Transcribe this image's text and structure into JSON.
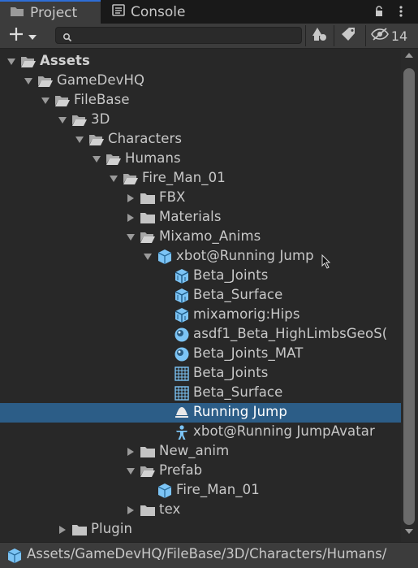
{
  "tabs": [
    {
      "label": "Project",
      "icon": "folder-icon",
      "active": true
    },
    {
      "label": "Console",
      "icon": "console-icon",
      "active": false
    }
  ],
  "toolbar": {
    "create_icon": "plus-icon",
    "search_value": "",
    "hidden_count": "14"
  },
  "tree": [
    {
      "label": "Assets",
      "icon": "folder-open-icon",
      "depth": 0,
      "expanded": true,
      "bold": true
    },
    {
      "label": "GameDevHQ",
      "icon": "folder-open-icon",
      "depth": 1,
      "expanded": true
    },
    {
      "label": "FileBase",
      "icon": "folder-open-icon",
      "depth": 2,
      "expanded": true
    },
    {
      "label": "3D",
      "icon": "folder-open-icon",
      "depth": 3,
      "expanded": true
    },
    {
      "label": "Characters",
      "icon": "folder-open-icon",
      "depth": 4,
      "expanded": true
    },
    {
      "label": "Humans",
      "icon": "folder-open-icon",
      "depth": 5,
      "expanded": true
    },
    {
      "label": "Fire_Man_01",
      "icon": "folder-open-icon",
      "depth": 6,
      "expanded": true
    },
    {
      "label": "FBX",
      "icon": "folder-icon",
      "depth": 7,
      "expanded": false
    },
    {
      "label": "Materials",
      "icon": "folder-icon",
      "depth": 7,
      "expanded": false
    },
    {
      "label": "Mixamo_Anims",
      "icon": "folder-open-icon",
      "depth": 7,
      "expanded": true
    },
    {
      "label": "xbot@Running Jump",
      "icon": "model-icon",
      "depth": 8,
      "expanded": true
    },
    {
      "label": "Beta_Joints",
      "icon": "mesh-icon",
      "depth": 9
    },
    {
      "label": "Beta_Surface",
      "icon": "mesh-icon",
      "depth": 9
    },
    {
      "label": "mixamorig:Hips",
      "icon": "mesh-icon",
      "depth": 9
    },
    {
      "label": "asdf1_Beta_HighLimbsGeoS(",
      "icon": "material-icon",
      "depth": 9
    },
    {
      "label": "Beta_Joints_MAT",
      "icon": "material-icon",
      "depth": 9
    },
    {
      "label": "Beta_Joints",
      "icon": "grid-mesh-icon",
      "depth": 9
    },
    {
      "label": "Beta_Surface",
      "icon": "grid-mesh-icon",
      "depth": 9
    },
    {
      "label": "Running Jump",
      "icon": "animation-clip-icon",
      "depth": 9,
      "selected": true
    },
    {
      "label": "xbot@Running JumpAvatar",
      "icon": "avatar-icon",
      "depth": 9
    },
    {
      "label": "New_anim",
      "icon": "folder-icon",
      "depth": 7,
      "expanded": false
    },
    {
      "label": "Prefab",
      "icon": "folder-open-icon",
      "depth": 7,
      "expanded": true
    },
    {
      "label": "Fire_Man_01",
      "icon": "prefab-icon",
      "depth": 8
    },
    {
      "label": "tex",
      "icon": "folder-icon",
      "depth": 7,
      "expanded": false
    },
    {
      "label": "Plugin",
      "icon": "folder-icon",
      "depth": 3,
      "expanded": false
    }
  ],
  "path": {
    "icon": "model-icon",
    "text": "Assets/GameDevHQ/FileBase/3D/Characters/Humans/"
  },
  "colors": {
    "background": "#282828",
    "selected_row": "#2c5d87",
    "active_tab_accent": "#2e6ed6",
    "asset_icon_blue": "#7cc4f5"
  }
}
